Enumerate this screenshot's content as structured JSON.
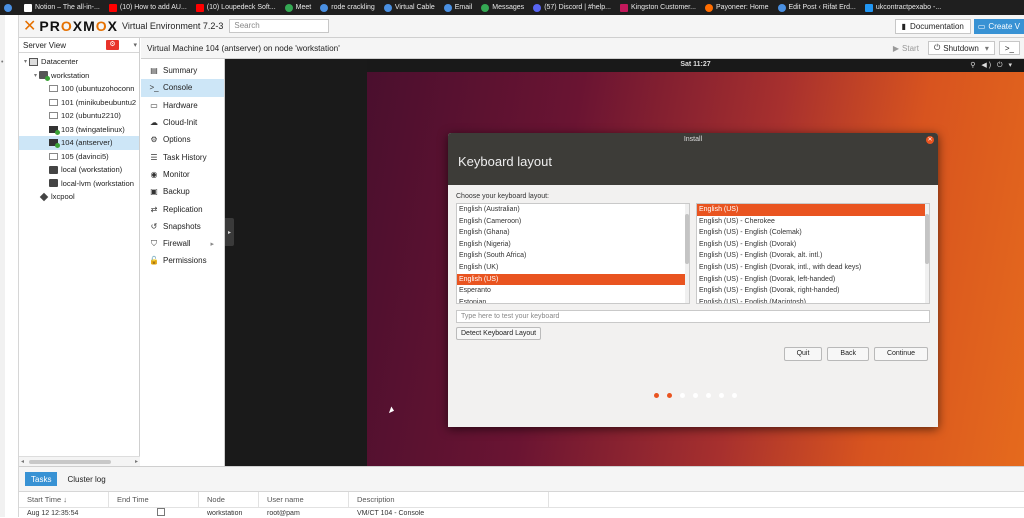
{
  "bookmarks": [
    {
      "label": "",
      "color": "#4a90e2",
      "shape": "circle"
    },
    {
      "label": "Notion – The all-in-...",
      "color": "#ffffff",
      "shape": "square"
    },
    {
      "label": "(10) How to add AU...",
      "color": "#ff0000",
      "shape": "square"
    },
    {
      "label": "(10) Loupedeck Soft...",
      "color": "#ff0000",
      "shape": "square"
    },
    {
      "label": "Meet",
      "color": "#34a853",
      "shape": "circle"
    },
    {
      "label": "rode crackling",
      "color": "#4a90e2",
      "shape": "circle"
    },
    {
      "label": "Virtual Cable",
      "color": "#4a90e2",
      "shape": "circle"
    },
    {
      "label": "Email",
      "color": "#4a90e2",
      "shape": "circle"
    },
    {
      "label": "Messages",
      "color": "#34a853",
      "shape": "circle"
    },
    {
      "label": "(57) Discord | #help...",
      "color": "#5865f2",
      "shape": "circle"
    },
    {
      "label": "Kingston Customer...",
      "color": "#c2185b",
      "shape": "square"
    },
    {
      "label": "Payoneer: Home",
      "color": "#ff6d00",
      "shape": "circle"
    },
    {
      "label": "Edit Post ‹ Rifat Erd...",
      "color": "#4a90e2",
      "shape": "circle"
    },
    {
      "label": "ukcontractpexabo -...",
      "color": "#2196f3",
      "shape": "square"
    }
  ],
  "header": {
    "logo_x": "✕",
    "logo_pr": "PR",
    "logo_o1": "O",
    "logo_xm": "XM",
    "logo_o2": "O",
    "logo_x2": "X",
    "version": "Virtual Environment 7.2-3",
    "search_placeholder": "Search",
    "documentation_label": "Documentation",
    "create_label": "Create V"
  },
  "tree": {
    "view_label": "Server View",
    "items": [
      {
        "label": "Datacenter",
        "indent": 0,
        "icon": "datacenter-icon",
        "twisty": "▾",
        "selected": false
      },
      {
        "label": "workstation",
        "indent": 1,
        "icon": "node-icon",
        "twisty": "▾",
        "selected": false
      },
      {
        "label": "100 (ubuntuzohoconn",
        "indent": 2,
        "icon": "vm-icon",
        "twisty": "",
        "selected": false
      },
      {
        "label": "101 (minikubeubuntu2",
        "indent": 2,
        "icon": "vm-icon",
        "twisty": "",
        "selected": false
      },
      {
        "label": "102 (ubuntu2210)",
        "indent": 2,
        "icon": "vm-icon",
        "twisty": "",
        "selected": false
      },
      {
        "label": "103 (twingatelinux)",
        "indent": 2,
        "icon": "vm-running-icon",
        "twisty": "",
        "selected": false
      },
      {
        "label": "104 (antserver)",
        "indent": 2,
        "icon": "vm-running-icon",
        "twisty": "",
        "selected": true
      },
      {
        "label": "105 (davinci5)",
        "indent": 2,
        "icon": "vm-icon",
        "twisty": "",
        "selected": false
      },
      {
        "label": "local (workstation)",
        "indent": 2,
        "icon": "storage-icon",
        "twisty": "",
        "selected": false
      },
      {
        "label": "local-lvm (workstation",
        "indent": 2,
        "icon": "storage-icon",
        "twisty": "",
        "selected": false
      },
      {
        "label": "lxcpool",
        "indent": 1,
        "icon": "pool-icon",
        "twisty": "",
        "selected": false
      }
    ]
  },
  "content": {
    "title": "Virtual Machine 104 (antserver) on node 'workstation'",
    "start_label": "Start",
    "shutdown_label": "Shutdown",
    "more_label": ">_"
  },
  "vm_nav": [
    {
      "label": "Summary",
      "icon": "summary-icon",
      "glyph": "▤",
      "selected": false,
      "submenu": false
    },
    {
      "label": "Console",
      "icon": "console-icon",
      "glyph": ">_",
      "selected": true,
      "submenu": false
    },
    {
      "label": "Hardware",
      "icon": "hardware-icon",
      "glyph": "▭",
      "selected": false,
      "submenu": false
    },
    {
      "label": "Cloud-Init",
      "icon": "cloud-icon",
      "glyph": "☁",
      "selected": false,
      "submenu": false
    },
    {
      "label": "Options",
      "icon": "gear-icon",
      "glyph": "⚙",
      "selected": false,
      "submenu": false
    },
    {
      "label": "Task History",
      "icon": "list-icon",
      "glyph": "☰",
      "selected": false,
      "submenu": false
    },
    {
      "label": "Monitor",
      "icon": "eye-icon",
      "glyph": "◉",
      "selected": false,
      "submenu": false
    },
    {
      "label": "Backup",
      "icon": "floppy-icon",
      "glyph": "▣",
      "selected": false,
      "submenu": false
    },
    {
      "label": "Replication",
      "icon": "retweet-icon",
      "glyph": "⇄",
      "selected": false,
      "submenu": false
    },
    {
      "label": "Snapshots",
      "icon": "history-icon",
      "glyph": "↺",
      "selected": false,
      "submenu": false
    },
    {
      "label": "Firewall",
      "icon": "shield-icon",
      "glyph": "⛉",
      "selected": false,
      "submenu": true
    },
    {
      "label": "Permissions",
      "icon": "unlock-icon",
      "glyph": "🔓",
      "selected": false,
      "submenu": false
    }
  ],
  "console": {
    "clock": "Sat 11:27",
    "tray": "⚲ ◀) ⏻ ▾",
    "installer": {
      "window_title": "Install",
      "heading": "Keyboard layout",
      "choose_label": "Choose your keyboard layout:",
      "layouts": [
        "English (Australian)",
        "English (Cameroon)",
        "English (Ghana)",
        "English (Nigeria)",
        "English (South Africa)",
        "English (UK)",
        "English (US)",
        "Esperanto",
        "Estonian"
      ],
      "layouts_selected": 6,
      "variants": [
        "English (US)",
        "English (US) - Cherokee",
        "English (US) - English (Colemak)",
        "English (US) - English (Dvorak)",
        "English (US) - English (Dvorak, alt. intl.)",
        "English (US) - English (Dvorak, intl., with dead keys)",
        "English (US) - English (Dvorak, left-handed)",
        "English (US) - English (Dvorak, right-handed)",
        "English (US) - English (Macintosh)"
      ],
      "variants_selected": 0,
      "test_placeholder": "Type here to test your keyboard",
      "detect_label": "Detect Keyboard Layout",
      "quit_label": "Quit",
      "back_label": "Back",
      "continue_label": "Continue"
    },
    "progress_dots": 7,
    "progress_active": [
      0,
      1
    ],
    "accent": "#e95420"
  },
  "bottom": {
    "tabs": [
      "Tasks",
      "Cluster log"
    ],
    "active_tab": 0,
    "columns": [
      "Start Time ↓",
      "End Time",
      "Node",
      "User name",
      "Description"
    ],
    "rows": [
      {
        "start": "Aug 12 12:35:54",
        "end": "",
        "node": "workstation",
        "user": "root@pam",
        "desc": "VM/CT 104 - Console"
      }
    ]
  }
}
